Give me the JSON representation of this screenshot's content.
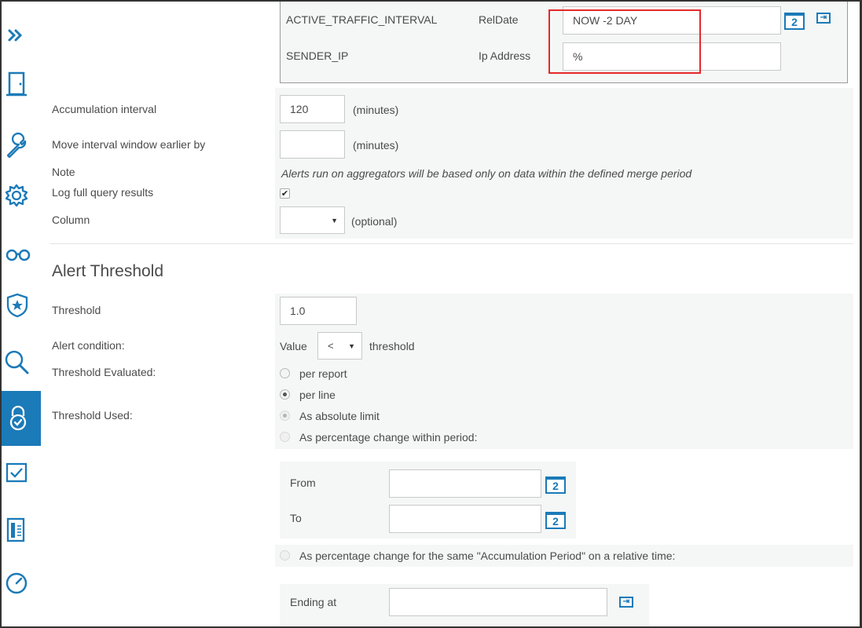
{
  "sidebar": {
    "items": [
      {
        "icon": "expand-chevrons-icon"
      },
      {
        "icon": "door-icon"
      },
      {
        "icon": "wrench-icon"
      },
      {
        "icon": "gear-icon"
      },
      {
        "icon": "glasses-icon"
      },
      {
        "icon": "shield-star-icon"
      },
      {
        "icon": "search-icon"
      },
      {
        "icon": "lock-check-icon",
        "active": true
      },
      {
        "icon": "checkbox-icon"
      },
      {
        "icon": "report-icon"
      },
      {
        "icon": "gauge-icon"
      }
    ],
    "active_color": "#1b7ab8"
  },
  "params": {
    "rows": [
      {
        "name": "ACTIVE_TRAFFIC_INTERVAL",
        "type": "RelDate",
        "value": "NOW -2 DAY",
        "calendar": "2",
        "goto": "⇥"
      },
      {
        "name": "SENDER_IP",
        "type": "Ip Address",
        "value": "%"
      }
    ]
  },
  "form": {
    "accumulation": {
      "label": "Accumulation interval",
      "value": "120",
      "unit": "(minutes)"
    },
    "move_window": {
      "label": "Move interval window earlier by",
      "value": "",
      "unit": "(minutes)"
    },
    "note": {
      "label": "Note",
      "text": "Alerts run on aggregators will be based only on data within the defined merge period"
    },
    "log_full": {
      "label": "Log full query results",
      "checked": true,
      "mark": "✔"
    },
    "column": {
      "label": "Column",
      "value": "",
      "hint": "(optional)",
      "arrow": "▼"
    }
  },
  "threshold": {
    "section_title": "Alert Threshold",
    "threshold": {
      "label": "Threshold",
      "value": "1.0"
    },
    "condition": {
      "label": "Alert condition:",
      "prefix": "Value",
      "operator": "<",
      "suffix": "threshold",
      "arrow": "▼"
    },
    "evaluated": {
      "label": "Threshold Evaluated:",
      "options": [
        "per report",
        "per line"
      ],
      "selected": "per line"
    },
    "used": {
      "label": "Threshold Used:",
      "options": [
        "As absolute limit",
        "As percentage change within period:"
      ],
      "selected": "As absolute limit"
    },
    "period": {
      "from_label": "From",
      "to_label": "To",
      "from_value": "",
      "to_value": "",
      "calendar": "2"
    },
    "relative_option": "As percentage change for the same \"Accumulation Period\" on a relative time:",
    "ending_at": {
      "label": "Ending at",
      "value": "",
      "goto": "⇥"
    }
  },
  "colors": {
    "accent": "#1b7ab8",
    "highlight": "#e5282a",
    "band": "#f4f7f6"
  }
}
